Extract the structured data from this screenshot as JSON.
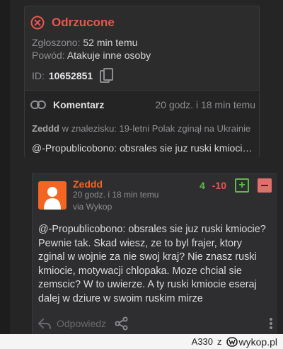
{
  "report": {
    "status": "Odrzucone",
    "reported_label": "Zgłoszono:",
    "reported_value": "52 min temu",
    "reason_label": "Powód:",
    "reason_value": "Atakuje inne osoby",
    "id_label": "ID:",
    "id_value": "10652851",
    "comment": {
      "title": "Komentarz",
      "time": "20 godz. i 18 min temu",
      "context_user": "Zeddd",
      "context_text": " w znalezisku: 19-letni Polak zginął na Ukrainie",
      "quote": "@-Propublicobono: obsrales sie juz ruski kmiocie? Pewnie tak."
    }
  },
  "post": {
    "author": "Zeddd",
    "time": "20 godz. i 18 min temu",
    "via": "via Wykop",
    "votes_plus": "4",
    "votes_minus": "-10",
    "plus_label": "+",
    "body": [
      "@-Propublicobono: obsrales sie juz ruski kmiocie?",
      "Pewnie tak. Skad wiesz, ze to byl frajer, ktory",
      "zginal w wojnie za nie swoj kraj? Nie znasz ruski",
      "kmiocie, motywacji chlopaka. Moze chcial sie",
      "zemscic? W to uwierze. A ty ruski kmiocie eseraj",
      "dalej w dziure w swoim ruskim mirze"
    ],
    "reply_label": "Odpowiedz"
  },
  "footer": {
    "user": "A330",
    "z": "z",
    "brand": "wykop.pl"
  },
  "colors": {
    "background": "#252526",
    "status_red": "#e8574d",
    "accent_orange": "#f26522",
    "vote_green": "#5fb84a"
  },
  "icons": [
    "x-circle-icon",
    "copy-icon",
    "link-icon",
    "user-avatar-icon",
    "plus-icon",
    "minus-icon",
    "reply-icon",
    "share-icon",
    "more-vertical-icon",
    "wykop-logo-icon"
  ]
}
